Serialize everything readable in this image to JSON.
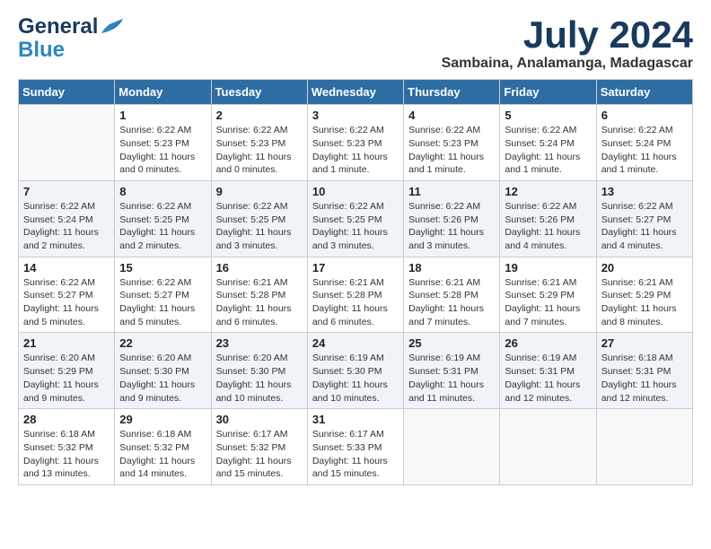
{
  "header": {
    "logo_line1": "General",
    "logo_line2": "Blue",
    "month": "July 2024",
    "location": "Sambaina, Analamanga, Madagascar"
  },
  "weekdays": [
    "Sunday",
    "Monday",
    "Tuesday",
    "Wednesday",
    "Thursday",
    "Friday",
    "Saturday"
  ],
  "weeks": [
    [
      {
        "day": "",
        "info": ""
      },
      {
        "day": "1",
        "info": "Sunrise: 6:22 AM\nSunset: 5:23 PM\nDaylight: 11 hours\nand 0 minutes."
      },
      {
        "day": "2",
        "info": "Sunrise: 6:22 AM\nSunset: 5:23 PM\nDaylight: 11 hours\nand 0 minutes."
      },
      {
        "day": "3",
        "info": "Sunrise: 6:22 AM\nSunset: 5:23 PM\nDaylight: 11 hours\nand 1 minute."
      },
      {
        "day": "4",
        "info": "Sunrise: 6:22 AM\nSunset: 5:23 PM\nDaylight: 11 hours\nand 1 minute."
      },
      {
        "day": "5",
        "info": "Sunrise: 6:22 AM\nSunset: 5:24 PM\nDaylight: 11 hours\nand 1 minute."
      },
      {
        "day": "6",
        "info": "Sunrise: 6:22 AM\nSunset: 5:24 PM\nDaylight: 11 hours\nand 1 minute."
      }
    ],
    [
      {
        "day": "7",
        "info": "Sunrise: 6:22 AM\nSunset: 5:24 PM\nDaylight: 11 hours\nand 2 minutes."
      },
      {
        "day": "8",
        "info": "Sunrise: 6:22 AM\nSunset: 5:25 PM\nDaylight: 11 hours\nand 2 minutes."
      },
      {
        "day": "9",
        "info": "Sunrise: 6:22 AM\nSunset: 5:25 PM\nDaylight: 11 hours\nand 3 minutes."
      },
      {
        "day": "10",
        "info": "Sunrise: 6:22 AM\nSunset: 5:25 PM\nDaylight: 11 hours\nand 3 minutes."
      },
      {
        "day": "11",
        "info": "Sunrise: 6:22 AM\nSunset: 5:26 PM\nDaylight: 11 hours\nand 3 minutes."
      },
      {
        "day": "12",
        "info": "Sunrise: 6:22 AM\nSunset: 5:26 PM\nDaylight: 11 hours\nand 4 minutes."
      },
      {
        "day": "13",
        "info": "Sunrise: 6:22 AM\nSunset: 5:27 PM\nDaylight: 11 hours\nand 4 minutes."
      }
    ],
    [
      {
        "day": "14",
        "info": "Sunrise: 6:22 AM\nSunset: 5:27 PM\nDaylight: 11 hours\nand 5 minutes."
      },
      {
        "day": "15",
        "info": "Sunrise: 6:22 AM\nSunset: 5:27 PM\nDaylight: 11 hours\nand 5 minutes."
      },
      {
        "day": "16",
        "info": "Sunrise: 6:21 AM\nSunset: 5:28 PM\nDaylight: 11 hours\nand 6 minutes."
      },
      {
        "day": "17",
        "info": "Sunrise: 6:21 AM\nSunset: 5:28 PM\nDaylight: 11 hours\nand 6 minutes."
      },
      {
        "day": "18",
        "info": "Sunrise: 6:21 AM\nSunset: 5:28 PM\nDaylight: 11 hours\nand 7 minutes."
      },
      {
        "day": "19",
        "info": "Sunrise: 6:21 AM\nSunset: 5:29 PM\nDaylight: 11 hours\nand 7 minutes."
      },
      {
        "day": "20",
        "info": "Sunrise: 6:21 AM\nSunset: 5:29 PM\nDaylight: 11 hours\nand 8 minutes."
      }
    ],
    [
      {
        "day": "21",
        "info": "Sunrise: 6:20 AM\nSunset: 5:29 PM\nDaylight: 11 hours\nand 9 minutes."
      },
      {
        "day": "22",
        "info": "Sunrise: 6:20 AM\nSunset: 5:30 PM\nDaylight: 11 hours\nand 9 minutes."
      },
      {
        "day": "23",
        "info": "Sunrise: 6:20 AM\nSunset: 5:30 PM\nDaylight: 11 hours\nand 10 minutes."
      },
      {
        "day": "24",
        "info": "Sunrise: 6:19 AM\nSunset: 5:30 PM\nDaylight: 11 hours\nand 10 minutes."
      },
      {
        "day": "25",
        "info": "Sunrise: 6:19 AM\nSunset: 5:31 PM\nDaylight: 11 hours\nand 11 minutes."
      },
      {
        "day": "26",
        "info": "Sunrise: 6:19 AM\nSunset: 5:31 PM\nDaylight: 11 hours\nand 12 minutes."
      },
      {
        "day": "27",
        "info": "Sunrise: 6:18 AM\nSunset: 5:31 PM\nDaylight: 11 hours\nand 12 minutes."
      }
    ],
    [
      {
        "day": "28",
        "info": "Sunrise: 6:18 AM\nSunset: 5:32 PM\nDaylight: 11 hours\nand 13 minutes."
      },
      {
        "day": "29",
        "info": "Sunrise: 6:18 AM\nSunset: 5:32 PM\nDaylight: 11 hours\nand 14 minutes."
      },
      {
        "day": "30",
        "info": "Sunrise: 6:17 AM\nSunset: 5:32 PM\nDaylight: 11 hours\nand 15 minutes."
      },
      {
        "day": "31",
        "info": "Sunrise: 6:17 AM\nSunset: 5:33 PM\nDaylight: 11 hours\nand 15 minutes."
      },
      {
        "day": "",
        "info": ""
      },
      {
        "day": "",
        "info": ""
      },
      {
        "day": "",
        "info": ""
      }
    ]
  ]
}
